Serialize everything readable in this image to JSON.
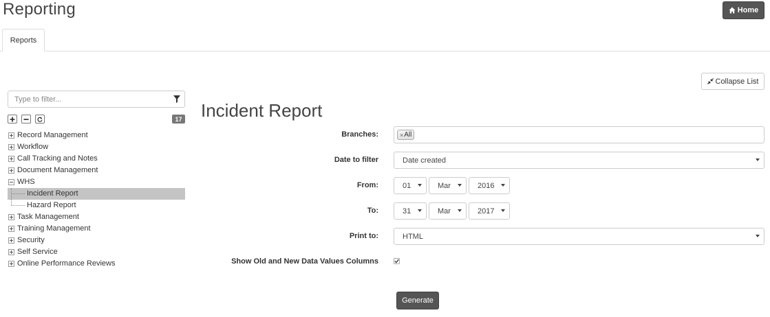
{
  "header": {
    "title": "Reporting",
    "home_label": "Home"
  },
  "tabs": [
    {
      "label": "Reports",
      "active": true
    }
  ],
  "toolbar": {
    "collapse_label": "Collapse List"
  },
  "sidebar": {
    "filter_placeholder": "Type to filter...",
    "count": "17",
    "items": [
      {
        "label": "Record Management",
        "expanded": false
      },
      {
        "label": "Workflow",
        "expanded": false
      },
      {
        "label": "Call Tracking and Notes",
        "expanded": false
      },
      {
        "label": "Document Management",
        "expanded": false
      },
      {
        "label": "WHS",
        "expanded": true,
        "children": [
          {
            "label": "Incident Report",
            "selected": true
          },
          {
            "label": "Hazard Report",
            "selected": false
          }
        ]
      },
      {
        "label": "Task Management",
        "expanded": false
      },
      {
        "label": "Training Management",
        "expanded": false
      },
      {
        "label": "Security",
        "expanded": false
      },
      {
        "label": "Self Service",
        "expanded": false
      },
      {
        "label": "Online Performance Reviews",
        "expanded": false
      }
    ]
  },
  "report": {
    "title": "Incident Report",
    "branches": {
      "label": "Branches:",
      "tag_remove": "×",
      "tag": "All"
    },
    "date_to_filter": {
      "label": "Date to filter",
      "value": "Date created"
    },
    "from": {
      "label": "From:",
      "day": "01",
      "month": "Mar",
      "year": "2016"
    },
    "to": {
      "label": "To:",
      "day": "31",
      "month": "Mar",
      "year": "2017"
    },
    "print_to": {
      "label": "Print to:",
      "value": "HTML"
    },
    "show_columns": {
      "label": "Show Old and New Data Values Columns",
      "checked": true
    },
    "generate_label": "Generate"
  },
  "colors": {
    "dark_button": "#555555",
    "selected_row": "#c4c4c4"
  }
}
